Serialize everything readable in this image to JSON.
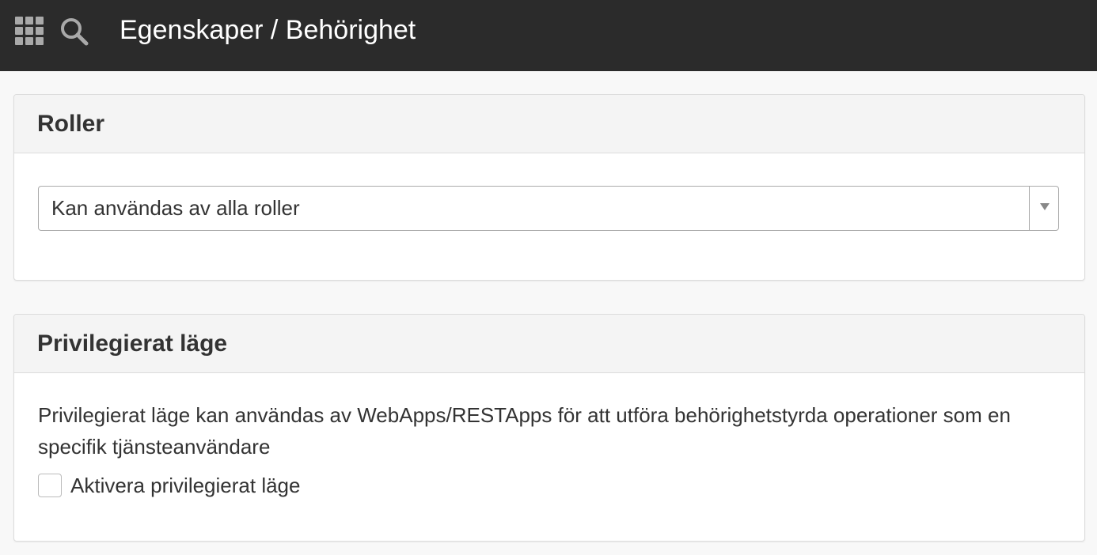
{
  "header": {
    "title": "Egenskaper / Behörighet",
    "background_color": "#2b2b2b",
    "icons": [
      "apps-grid-icon",
      "search-icon"
    ]
  },
  "roles_panel": {
    "title": "Roller",
    "select": {
      "selected_value": "Kan användas av alla roller"
    }
  },
  "privileged_panel": {
    "title": "Privilegierat läge",
    "description": "Privilegierat läge kan användas av WebApps/RESTApps för att utföra behörighetstyrda operationer som en specifik tjänsteanvändare",
    "checkbox": {
      "label": "Aktivera privilegierat läge",
      "checked": false
    }
  }
}
